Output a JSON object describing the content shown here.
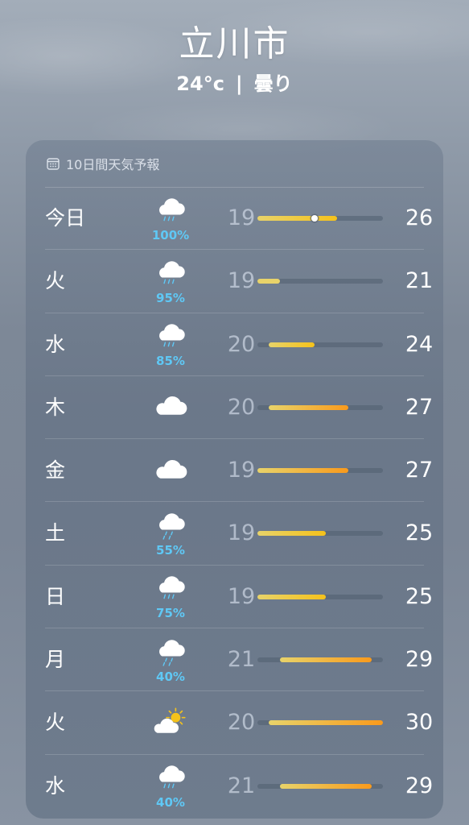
{
  "header": {
    "city": "立川市",
    "temp": "24°c",
    "separator": "|",
    "condition": "曇り"
  },
  "forecast": {
    "title": "10日間天気予報",
    "icon": "calendar-icon",
    "scale": {
      "min": 19,
      "max": 30
    },
    "current_temp": 24,
    "days": [
      {
        "day": "今日",
        "icon": "rain-cloud-icon",
        "precip": "100%",
        "low": "19",
        "high": "26",
        "lo": 19,
        "hi": 26,
        "current": true
      },
      {
        "day": "火",
        "icon": "rain-cloud-icon",
        "precip": "95%",
        "low": "19",
        "high": "21",
        "lo": 19,
        "hi": 21
      },
      {
        "day": "水",
        "icon": "rain-cloud-icon",
        "precip": "85%",
        "low": "20",
        "high": "24",
        "lo": 20,
        "hi": 24
      },
      {
        "day": "木",
        "icon": "cloud-icon",
        "precip": "",
        "low": "20",
        "high": "27",
        "lo": 20,
        "hi": 27
      },
      {
        "day": "金",
        "icon": "cloud-icon",
        "precip": "",
        "low": "19",
        "high": "27",
        "lo": 19,
        "hi": 27
      },
      {
        "day": "土",
        "icon": "drizzle-cloud-icon",
        "precip": "55%",
        "low": "19",
        "high": "25",
        "lo": 19,
        "hi": 25
      },
      {
        "day": "日",
        "icon": "rain-cloud-icon",
        "precip": "75%",
        "low": "19",
        "high": "25",
        "lo": 19,
        "hi": 25
      },
      {
        "day": "月",
        "icon": "drizzle-cloud-icon",
        "precip": "40%",
        "low": "21",
        "high": "29",
        "lo": 21,
        "hi": 29
      },
      {
        "day": "火",
        "icon": "partly-cloudy-sun-icon",
        "precip": "",
        "low": "20",
        "high": "30",
        "lo": 20,
        "hi": 30
      },
      {
        "day": "水",
        "icon": "rain-cloud-icon",
        "precip": "40%",
        "low": "21",
        "high": "29",
        "lo": 21,
        "hi": 29
      }
    ]
  },
  "colors": {
    "precip": "#5fc8f5",
    "bar_cool": "#e8d36a",
    "bar_mid": "#f5c21b",
    "bar_warm": "#f99a1c"
  }
}
